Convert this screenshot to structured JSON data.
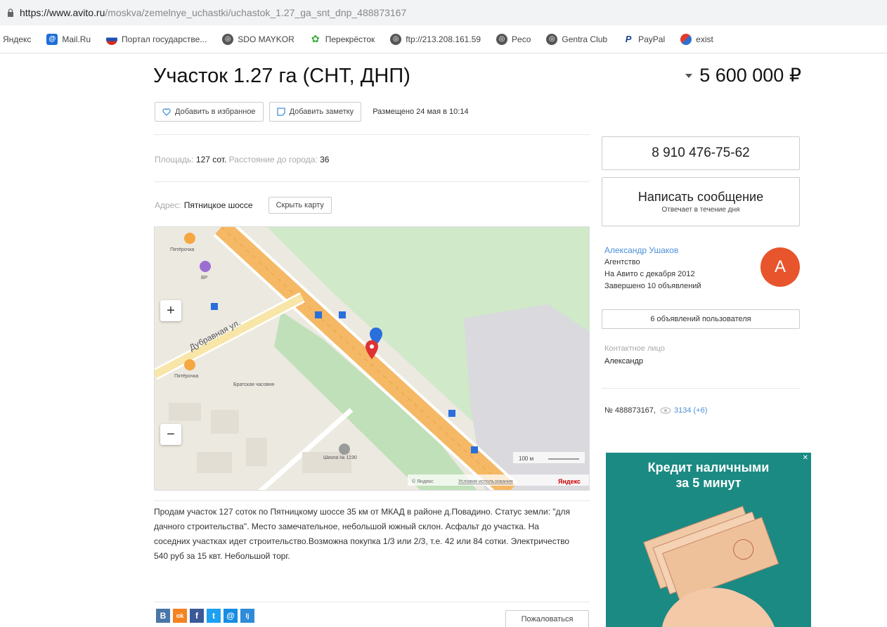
{
  "browser": {
    "url_host": "https://www.avito.ru",
    "url_path": "/moskva/zemelnye_uchastki/uchastok_1.27_ga_snt_dnp_488873167",
    "bookmarks": [
      {
        "label": "Яндекс",
        "icon": "yandex-icon"
      },
      {
        "label": "Mail.Ru",
        "icon": "mailru-icon"
      },
      {
        "label": "Портал государстве...",
        "icon": "gosuslugi-icon"
      },
      {
        "label": "SDO MAYKOR",
        "icon": "globe-icon"
      },
      {
        "label": "Перекрёсток",
        "icon": "leaf-icon"
      },
      {
        "label": "ftp://213.208.161.59",
        "icon": "globe-icon"
      },
      {
        "label": "Peco",
        "icon": "globe-icon"
      },
      {
        "label": "Gentra Club",
        "icon": "globe-icon"
      },
      {
        "label": "PayPal",
        "icon": "paypal-icon"
      },
      {
        "label": "exist",
        "icon": "exist-icon"
      }
    ]
  },
  "listing": {
    "title": "Участок 1.27 га (СНТ, ДНП)",
    "price": "5 600 000 ₽",
    "add_favorite": "Добавить в избранное",
    "add_note": "Добавить заметку",
    "posted": "Размещено 24 мая в 10:14",
    "area_label": "Площадь:",
    "area_value": "127 сот.",
    "distance_label": "Расстояние до города:",
    "distance_value": "36",
    "address_label": "Адрес:",
    "address_value": "Пятницкое шоссе",
    "hide_map": "Скрыть карту",
    "description": "Продам участок 127 соток по Пятницкому шоссе 35 км от МКАД в районе д.Повадино. Статус земли: \"для дачного строительства\". Место замечательное, небольшой южный склон. Асфальт до участка. На соседних участках идет строительство.Возможна покупка 1/3 или 2/3, т.е. 42 или 84 сотки. Электричество 540 руб за 15 квт. Небольшой торг.",
    "complain": "Пожаловаться"
  },
  "map": {
    "zoom_in": "+",
    "zoom_out": "−",
    "street": "Дубравная ул.",
    "poi_1": "Пятёрочка",
    "poi_2": "ВР",
    "poi_3": "Пятёрочка",
    "poi_4": "Братская часовня",
    "poi_5": "Школа № 1190",
    "scale": "100 м",
    "copyright": "© Яндекс",
    "terms": "Условия использования",
    "logo": "Яндекс"
  },
  "sidebar": {
    "phone": "8 910 476-75-62",
    "message": "Написать сообщение",
    "message_sub": "Отвечает в течение дня",
    "seller_name": "Александр Ушаков",
    "seller_type": "Агентство",
    "seller_since": "На Авито с декабря 2012",
    "seller_done": "Завершено 10 объявлений",
    "avatar_letter": "А",
    "user_ads": "6 объявлений пользователя",
    "contact_label": "Контактное лицо",
    "contact_name": "Александр",
    "item_number": "№ 488873167,",
    "views": "3134 (+6)"
  },
  "banner": {
    "line1": "Кредит наличными",
    "line2": "за 5 минут"
  },
  "share": {
    "vk": "B",
    "ok": "ok",
    "fb": "f",
    "tw": "t",
    "mail": "@",
    "lj": "lj"
  }
}
